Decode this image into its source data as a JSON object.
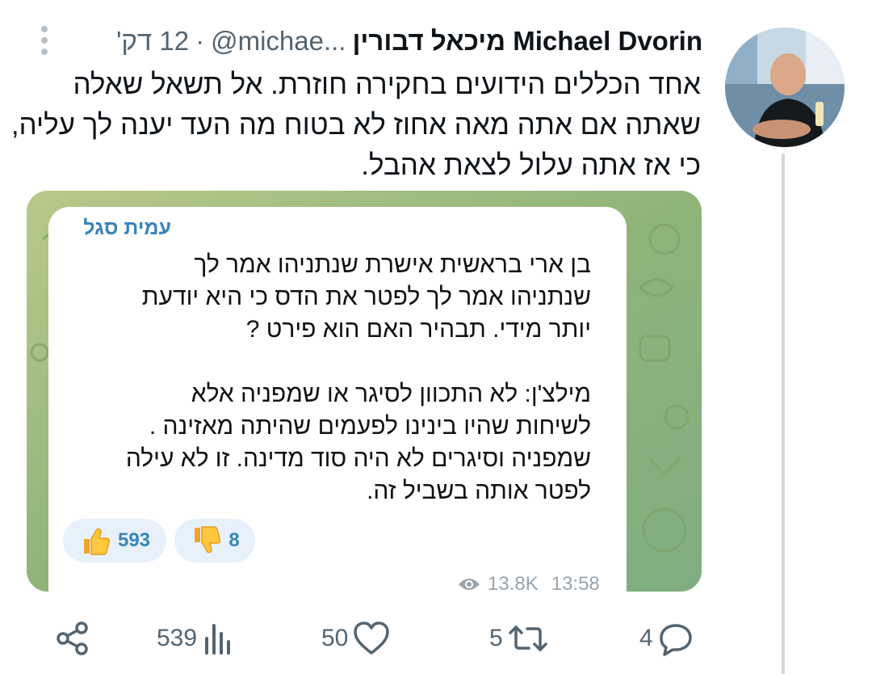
{
  "tweet": {
    "author_name": "מיכאל דבורין Michael Dvorin",
    "handle": "@michae...",
    "separator": "·",
    "time": "12 דק'",
    "text_lines": [
      "אחד הכללים הידועים בחקירה חוזרת. אל תשאל שאלה",
      "שאתה אם אתה מאה אחוז לא בטוח מה העד יענה לך עליה,",
      "כי אז אתה עלול לצאת אהבל."
    ]
  },
  "media": {
    "sender": "עמית סגל",
    "message_lines": [
      "בן ארי בראשית אישרת שנתניהו אמר לך",
      "שנתניהו אמר לך לפטר את הדס כי היא יודעת",
      "יותר מידי. תבהיר האם הוא פירט ?",
      "",
      "מילצ'ן: לא התכוון לסיגר או שמפניה אלא",
      "לשיחות שהיו בינינו לפעמים שהיתה מאזינה .",
      "שמפניה וסיגרים לא היה סוד מדינה. זו לא עילה",
      "לפטר אותה בשביל זה."
    ],
    "reactions": {
      "like_count": "593",
      "dislike_count": "8"
    },
    "views": "13.8K",
    "time": "13:58"
  },
  "actions": {
    "replies": "4",
    "reposts": "5",
    "likes": "50",
    "views": "539"
  },
  "icons": {
    "more": "more-vertical-icon",
    "reply": "reply-icon",
    "repost": "repost-icon",
    "like": "heart-icon",
    "views": "analytics-icon",
    "share": "share-icon",
    "eye": "eye-icon",
    "thumbs_up": "thumbs-up-emoji",
    "thumbs_down": "thumbs-down-emoji"
  },
  "colors": {
    "text": "#0f1419",
    "muted": "#536471",
    "telegram_name": "#3a84b9",
    "telegram_bg": "#93b77c",
    "reaction_bg": "#e7f1fb"
  }
}
